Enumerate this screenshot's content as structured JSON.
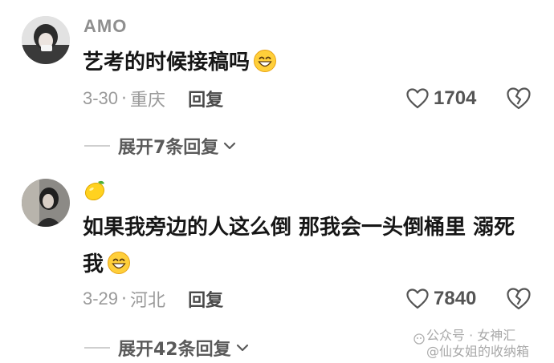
{
  "comments": [
    {
      "username": "AMO",
      "text": "艺考的时候接稿吗",
      "date": "3-30",
      "location": "重庆",
      "reply_label": "回复",
      "likes": "1704",
      "expand_label": "展开7条回复"
    },
    {
      "username_emoji": "lemon",
      "text": "如果我旁边的人这么倒 那我会一头倒桶里 溺死我",
      "date": "3-29",
      "location": "河北",
      "reply_label": "回复",
      "likes": "7840",
      "expand_label": "展开42条回复"
    }
  ],
  "separator": "·",
  "watermark": {
    "line1": "公众号 · 女神汇",
    "line2": "@仙女姐的收纳箱"
  },
  "icons": {
    "like": "heart-outline-icon",
    "dislike": "broken-heart-icon",
    "expand": "chevron-down-icon",
    "emoji": "grinning-face-icon",
    "lemon": "lemon-icon"
  }
}
